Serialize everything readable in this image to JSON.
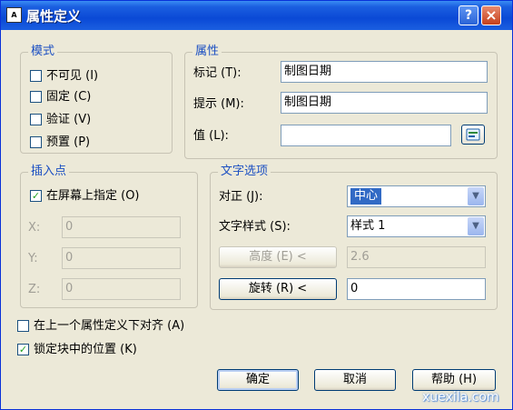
{
  "window": {
    "title": "属性定义",
    "help_glyph": "?",
    "close_glyph": "×"
  },
  "mode": {
    "legend": "模式",
    "items": [
      {
        "label": "不可见 (I)",
        "checked": false
      },
      {
        "label": "固定 (C)",
        "checked": false
      },
      {
        "label": "验证 (V)",
        "checked": false
      },
      {
        "label": "预置 (P)",
        "checked": false
      }
    ]
  },
  "attribute": {
    "legend": "属性",
    "tag_label": "标记 (T):",
    "tag_value": "制图日期",
    "prompt_label": "提示 (M):",
    "prompt_value": "制图日期",
    "value_label": "值 (L):",
    "value_value": ""
  },
  "insertion": {
    "legend": "插入点",
    "on_screen_label": "在屏幕上指定 (O)",
    "on_screen_checked": true,
    "x_label": "X:",
    "x_value": "0",
    "y_label": "Y:",
    "y_value": "0",
    "z_label": "Z:",
    "z_value": "0"
  },
  "text_options": {
    "legend": "文字选项",
    "justify_label": "对正 (J):",
    "justify_value": "中心",
    "style_label": "文字样式 (S):",
    "style_value": "样式 1",
    "height_button": "高度 (E) <",
    "height_value": "2.6",
    "rotation_button": "旋转 (R) <",
    "rotation_value": "0"
  },
  "bottom": {
    "align_below_label": "在上一个属性定义下对齐 (A)",
    "align_below_checked": false,
    "lock_position_label": "锁定块中的位置 (K)",
    "lock_position_checked": true
  },
  "buttons": {
    "ok": "确定",
    "cancel": "取消",
    "help": "帮助 (H)"
  },
  "watermark": "xuexila.com",
  "glyphs": {
    "check": "✓",
    "dropdown": "▼"
  },
  "colors": {
    "titlebar": "#0a49d6",
    "legend_text": "#1b4fc2",
    "selection": "#316ac5",
    "dialog_bg": "#ece9d8"
  }
}
